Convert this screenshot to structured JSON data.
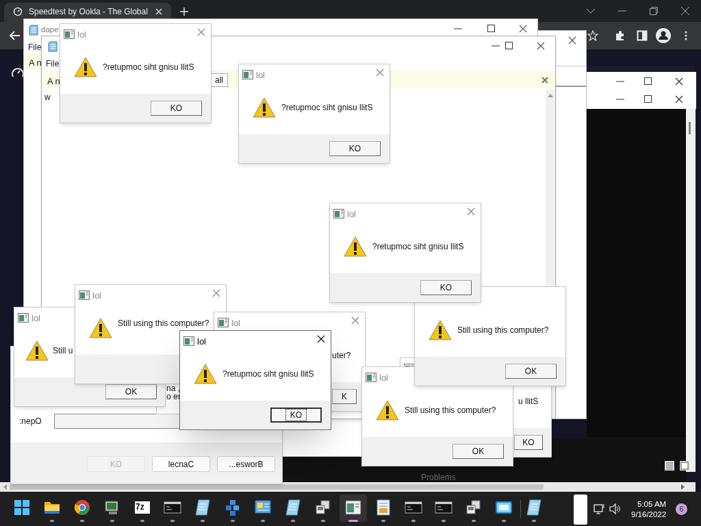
{
  "browser": {
    "tab_title": "Speedtest by Ookla - The Global"
  },
  "notepads": [
    {
      "title": "dape",
      "menu": "File",
      "notice": "A n"
    },
    {
      "menu": "File",
      "notice": "A n",
      "notice_button": "all",
      "body": "w"
    }
  ],
  "terminal": {
    "panel_tab": "Problems"
  },
  "run_dialog": {
    "label": ":nepO",
    "buttons": [
      {
        "label": "KO",
        "disabled": true
      },
      {
        "label": "lecnaC",
        "disabled": false
      },
      {
        "label": "...esworB",
        "disabled": false
      }
    ]
  },
  "partial_window": {
    "lines": [
      "na ,",
      "o er"
    ]
  },
  "dialogs": [
    {
      "title": "lol",
      "message": "?retupmoc siht gnisu llitS",
      "button": "KO",
      "active": false,
      "focused": false
    },
    {
      "title": "lol",
      "message": "?retupmoc siht gnisu llitS",
      "button": "KO",
      "active": false,
      "focused": false
    },
    {
      "title": "lol",
      "message": "Still u",
      "button": "OK",
      "active": false,
      "focused": false
    },
    {
      "title": "lol",
      "message": "Still using this computer?",
      "active": false
    },
    {
      "title": "lol",
      "message": "uter?",
      "button": "K",
      "active": false,
      "focused": false
    },
    {
      "title": "lol",
      "message": "?retupmoc siht gnisu llitS",
      "button": "KO",
      "active": true,
      "focused": true
    },
    {
      "message": "u llitS",
      "button": "KO",
      "active": false,
      "focused": false
    },
    {
      "title": "lol",
      "message": "Still using this computer?",
      "button": "OK",
      "active": false,
      "focused": false
    },
    {
      "message": "Still using this computer?",
      "button": "OK",
      "active": false,
      "focused": false
    },
    {
      "title": "lol",
      "message": "?retupmoc siht gnisu llitS",
      "button": "KO",
      "active": false,
      "focused": false
    }
  ],
  "taskbar": {
    "apps": [
      {
        "kind": "start",
        "selected": false
      },
      {
        "kind": "folder",
        "selected": false
      },
      {
        "kind": "round",
        "selected": false
      },
      {
        "kind": "monitor",
        "selected": false
      },
      {
        "kind": "archive",
        "label": "7z",
        "selected": false
      },
      {
        "kind": "terminal",
        "selected": false
      },
      {
        "kind": "notepad",
        "selected": false
      },
      {
        "kind": "cubes",
        "selected": false
      },
      {
        "kind": "panel",
        "selected": false
      },
      {
        "kind": "notepad",
        "selected": false
      },
      {
        "kind": "computers",
        "selected": false
      },
      {
        "kind": "window",
        "selected": true
      },
      {
        "kind": "document",
        "selected": false
      },
      {
        "kind": "terminal",
        "selected": false
      },
      {
        "kind": "terminal",
        "selected": false
      },
      {
        "kind": "computers",
        "selected": false
      },
      {
        "kind": "screen",
        "selected": false
      },
      {
        "kind": "notepad",
        "selected": false
      }
    ],
    "time": "5:05 AM",
    "date": "9/16/2022",
    "badge": "6"
  }
}
